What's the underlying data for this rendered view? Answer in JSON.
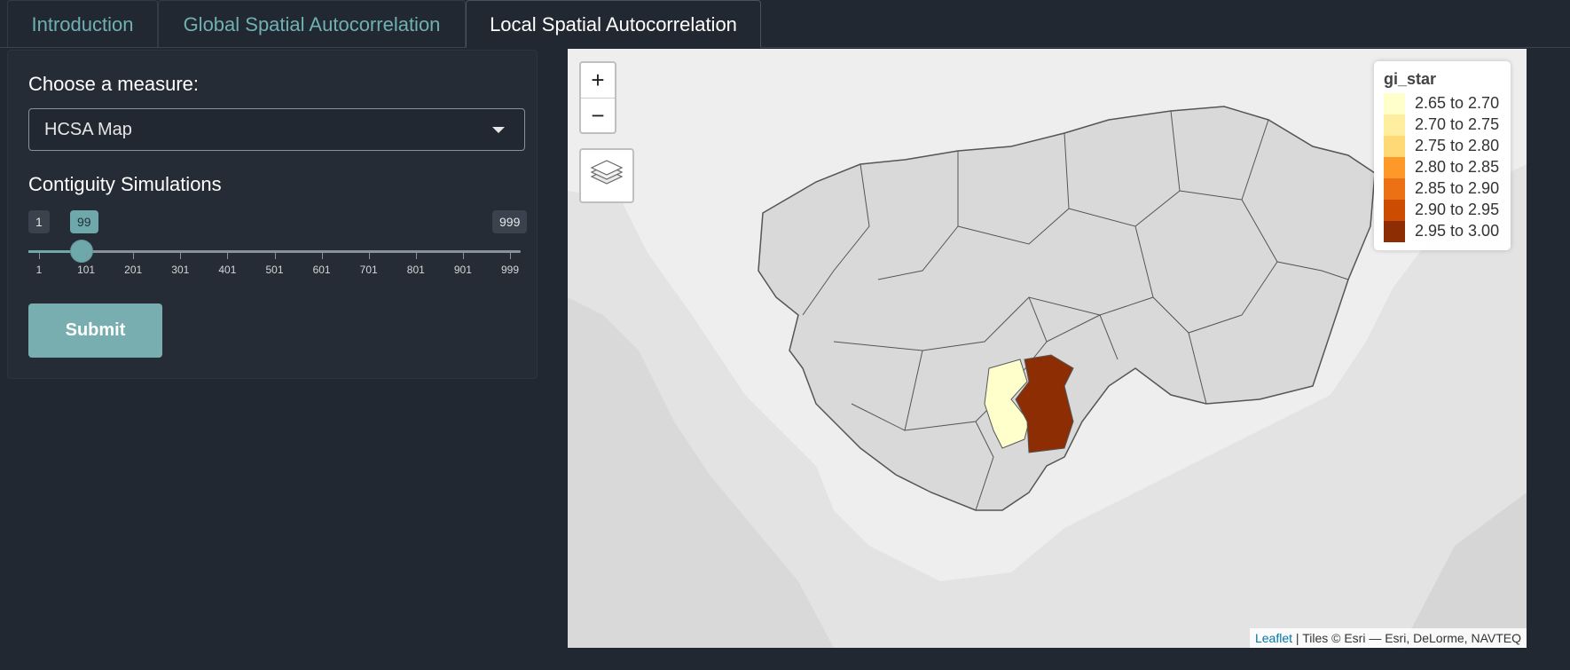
{
  "tabs": [
    {
      "label": "Introduction"
    },
    {
      "label": "Global Spatial Autocorrelation"
    },
    {
      "label": "Local Spatial Autocorrelation"
    }
  ],
  "sidebar": {
    "measure_label": "Choose a measure:",
    "measure_value": "HCSA Map",
    "simulations_label": "Contiguity Simulations",
    "slider": {
      "min": "1",
      "value": "99",
      "max": "999",
      "ticks": [
        "1",
        "101",
        "201",
        "301",
        "401",
        "501",
        "601",
        "701",
        "801",
        "901",
        "999"
      ]
    },
    "submit_label": "Submit"
  },
  "map": {
    "zoom_in": "+",
    "zoom_out": "−",
    "legend": {
      "title": "gi_star",
      "items": [
        {
          "label": "2.65 to 2.70",
          "color": "#ffffcc"
        },
        {
          "label": "2.70 to 2.75",
          "color": "#ffeda0"
        },
        {
          "label": "2.75 to 2.80",
          "color": "#fed976"
        },
        {
          "label": "2.80 to 2.85",
          "color": "#fe9929"
        },
        {
          "label": "2.85 to 2.90",
          "color": "#ec7014"
        },
        {
          "label": "2.90 to 2.95",
          "color": "#cc4c02"
        },
        {
          "label": "2.95 to 3.00",
          "color": "#8c2d04"
        }
      ]
    },
    "attribution_link": "Leaflet",
    "attribution_text": " | Tiles © Esri — Esri, DeLorme, NAVTEQ"
  }
}
